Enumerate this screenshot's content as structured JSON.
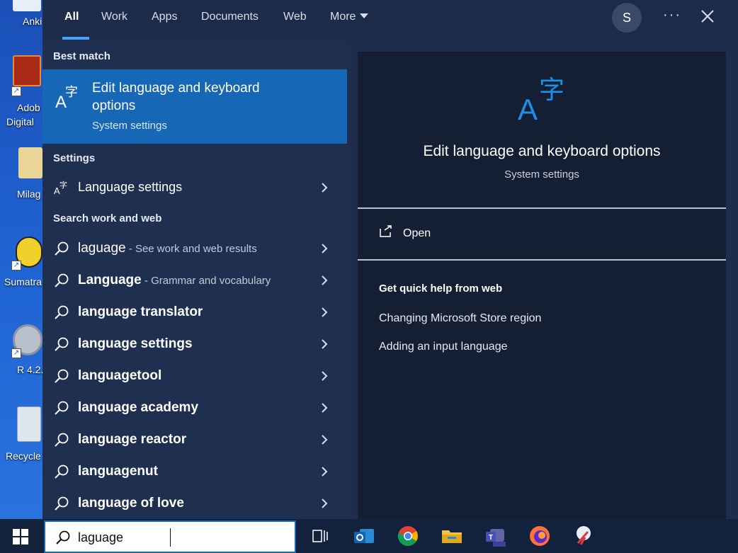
{
  "desktop": {
    "icons": [
      {
        "label": "Anki"
      },
      {
        "label": "Adob"
      },
      {
        "label": "Digital"
      },
      {
        "label": "Milag"
      },
      {
        "label": "Sumatra"
      },
      {
        "label": "R 4.2."
      },
      {
        "label": "Recycle"
      }
    ]
  },
  "search": {
    "tabs": [
      {
        "label": "All"
      },
      {
        "label": "Work"
      },
      {
        "label": "Apps"
      },
      {
        "label": "Documents"
      },
      {
        "label": "Web"
      },
      {
        "label": "More"
      }
    ],
    "avatar_initial": "S",
    "more_options": "···",
    "best_match_header": "Best match",
    "best_match": {
      "title": "Edit language and keyboard options",
      "subtitle": "System settings"
    },
    "settings_header": "Settings",
    "settings_items": [
      {
        "label": "Language settings"
      }
    ],
    "web_header": "Search work and web",
    "web_items": [
      {
        "main": "laguage",
        "bold": false,
        "hint": " - See work and web results"
      },
      {
        "main": "Language",
        "bold": true,
        "hint": " - Grammar and vocabulary"
      },
      {
        "main": "language translator",
        "bold": true,
        "hint": ""
      },
      {
        "main": "language settings",
        "bold": true,
        "hint": ""
      },
      {
        "main": "languagetool",
        "bold": true,
        "hint": ""
      },
      {
        "main": "language academy",
        "bold": true,
        "hint": ""
      },
      {
        "main": "language reactor",
        "bold": true,
        "hint": ""
      },
      {
        "main": "languagenut",
        "bold": true,
        "hint": ""
      },
      {
        "main": "language of love",
        "bold": true,
        "hint": ""
      }
    ],
    "preview": {
      "title": "Edit language and keyboard options",
      "subtitle": "System settings",
      "open_label": "Open",
      "help_header": "Get quick help from web",
      "help_links": [
        {
          "label": "Changing Microsoft Store region"
        },
        {
          "label": "Adding an input language"
        }
      ]
    }
  },
  "taskbar": {
    "search_query": "laguage",
    "apps": [
      {
        "icon": "task-view-icon"
      },
      {
        "icon": "outlook-icon"
      },
      {
        "icon": "chrome-icon"
      },
      {
        "icon": "file-explorer-icon"
      },
      {
        "icon": "teams-icon"
      },
      {
        "icon": "firefox-icon"
      },
      {
        "icon": "snipping-tool-icon"
      }
    ]
  },
  "colors": {
    "accent": "#1668b6",
    "panel": "#1e2f4f",
    "preview_bg": "#141f33",
    "taskbar": "#13223c"
  }
}
